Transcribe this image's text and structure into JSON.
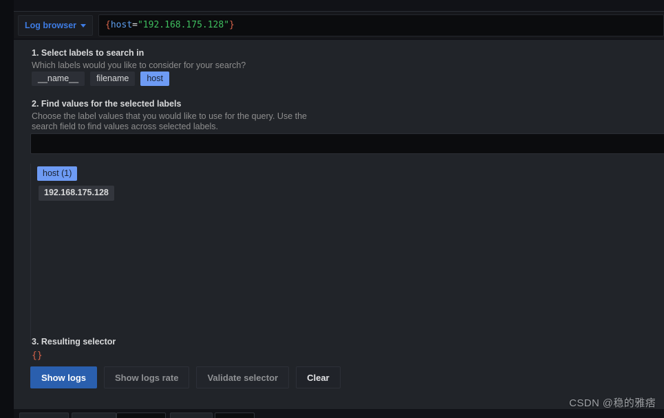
{
  "query_bar": {
    "log_browser_label": "Log browser",
    "chevron_icon": "chevron-down-icon",
    "expression": {
      "open_brace": "{",
      "label": "host",
      "operator": "=",
      "value": "\"192.168.175.128\"",
      "close_brace": "}",
      "full": "{host=\"192.168.175.128\"}"
    }
  },
  "section1": {
    "title": "1. Select labels to search in",
    "description": "Which labels would you like to consider for your search?",
    "labels": [
      {
        "name": "__name__",
        "selected": false
      },
      {
        "name": "filename",
        "selected": false
      },
      {
        "name": "host",
        "selected": true
      }
    ]
  },
  "section2": {
    "title": "2. Find values for the selected labels",
    "description": "Choose the label values that you would like to use for the query. Use the search field to find values across selected labels.",
    "search_placeholder": "",
    "search_value": "",
    "columns": [
      {
        "header": "host (1)",
        "values": [
          "192.168.175.128"
        ]
      }
    ]
  },
  "section3": {
    "title": "3. Resulting selector",
    "selector": "{}",
    "buttons": [
      {
        "label": "Show logs",
        "style": "primary"
      },
      {
        "label": "Show logs rate",
        "style": "secondary"
      },
      {
        "label": "Validate selector",
        "style": "secondary"
      },
      {
        "label": "Clear",
        "style": "clear"
      }
    ]
  },
  "watermark": "CSDN @稳的雅痞",
  "colors": {
    "accent_blue": "#3e7ce4",
    "primary_button": "#2a5fae",
    "chip_selected": "#6e9bf4",
    "panel_bg": "#212429",
    "field_bg": "#0b0c0e",
    "syntax_brace": "#d9644a",
    "syntax_label": "#5c9ded",
    "syntax_string": "#3fbf5f"
  }
}
